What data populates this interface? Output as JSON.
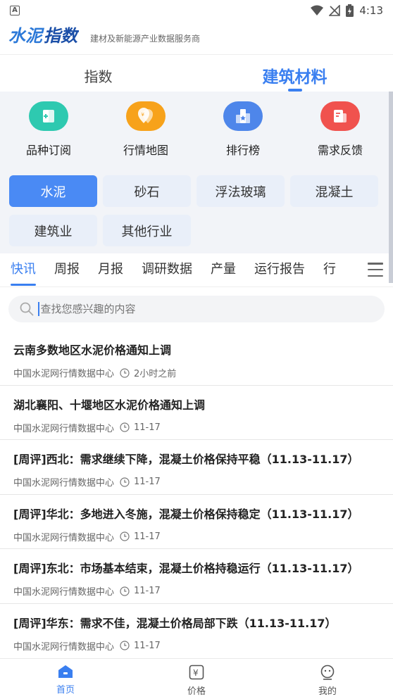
{
  "status": {
    "time": "4:13",
    "badge": "A"
  },
  "header": {
    "logo_text": "水泥指数",
    "slogan": "建材及新能源产业数据服务商"
  },
  "main_tabs": [
    {
      "label": "指数",
      "active": false
    },
    {
      "label": "建筑材料",
      "active": true
    }
  ],
  "quick_actions": [
    {
      "label": "品种订阅",
      "icon": "subscribe-icon",
      "color": "#2ec9b0"
    },
    {
      "label": "行情地图",
      "icon": "map-icon",
      "color": "#f7a21b"
    },
    {
      "label": "排行榜",
      "icon": "ranking-icon",
      "color": "#4e86ea"
    },
    {
      "label": "需求反馈",
      "icon": "feedback-icon",
      "color": "#f0524e"
    }
  ],
  "categories": [
    {
      "label": "水泥",
      "active": true
    },
    {
      "label": "砂石",
      "active": false
    },
    {
      "label": "浮法玻璃",
      "active": false
    },
    {
      "label": "混凝土",
      "active": false
    },
    {
      "label": "建筑业",
      "active": false
    },
    {
      "label": "其他行业",
      "active": false
    }
  ],
  "sub_tabs": [
    {
      "label": "快讯",
      "active": true
    },
    {
      "label": "周报",
      "active": false
    },
    {
      "label": "月报",
      "active": false
    },
    {
      "label": "调研数据",
      "active": false
    },
    {
      "label": "产量",
      "active": false
    },
    {
      "label": "运行报告",
      "active": false
    },
    {
      "label": "行",
      "active": false
    }
  ],
  "search": {
    "placeholder": "查找您感兴趣的内容"
  },
  "news": [
    {
      "title": "云南多数地区水泥价格通知上调",
      "source": "中国水泥网行情数据中心",
      "time": "2小时之前"
    },
    {
      "title": "湖北襄阳、十堰地区水泥价格通知上调",
      "source": "中国水泥网行情数据中心",
      "time": "11-17"
    },
    {
      "title": "[周评]西北：需求继续下降，混凝土价格保持平稳（11.13-11.17）",
      "source": "中国水泥网行情数据中心",
      "time": "11-17"
    },
    {
      "title": "[周评]华北：多地进入冬施，混凝土价格保持稳定（11.13-11.17）",
      "source": "中国水泥网行情数据中心",
      "time": "11-17"
    },
    {
      "title": "[周评]东北：市场基本结束，混凝土价格持稳运行（11.13-11.17）",
      "source": "中国水泥网行情数据中心",
      "time": "11-17"
    },
    {
      "title": "[周评]华东：需求不佳，混凝土价格局部下跌（11.13-11.17）",
      "source": "中国水泥网行情数据中心",
      "time": "11-17"
    }
  ],
  "bottom_nav": [
    {
      "label": "首页",
      "icon": "home-icon",
      "active": true
    },
    {
      "label": "价格",
      "icon": "price-icon",
      "active": false
    },
    {
      "label": "我的",
      "icon": "profile-icon",
      "active": false
    }
  ],
  "colors": {
    "accent": "#3a7ff0"
  }
}
